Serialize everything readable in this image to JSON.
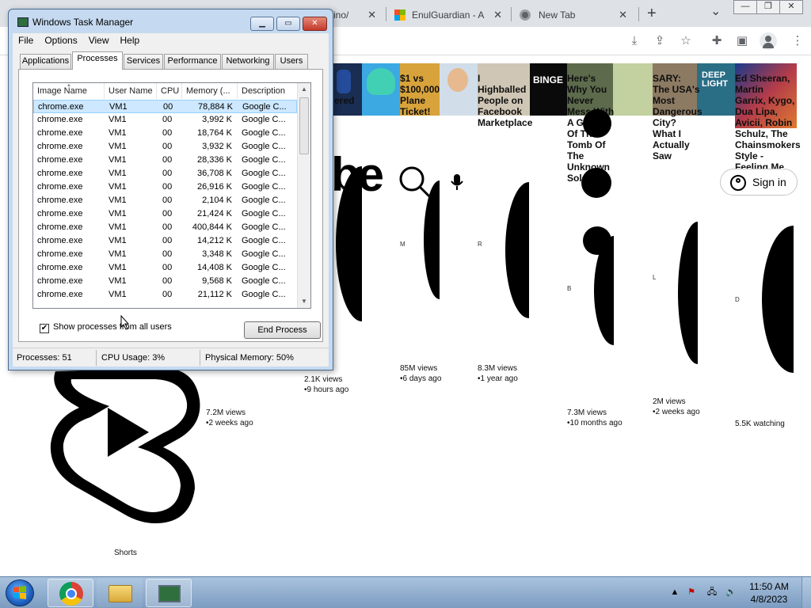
{
  "chrome": {
    "tabs": [
      {
        "label": "ino/"
      },
      {
        "label": "EnulGuardian - A"
      },
      {
        "label": "New Tab"
      }
    ],
    "new_tab_symbol": "+",
    "dropdown_symbol": "⌄",
    "close_symbol": "✕",
    "icons": [
      "download-icon",
      "share-icon",
      "bookmark-star-icon",
      "extensions-icon",
      "side-panel-icon",
      "profile-icon"
    ]
  },
  "youtube": {
    "sign_in_label": "Sign in",
    "logo_fragment": "be",
    "shorts_label": "Shorts",
    "binge_badge": "BINGE",
    "deep_light_badge": "DEEP LIGHT",
    "video_titles": [
      "ered",
      "$1 vs $100,000 Plane Ticket!",
      "I Highballed People on Facebook Marketplace",
      "Here's Why You Never Mess With A Guard Of The Tomb Of The Unknown Soldier",
      "SARY: The USA's Most Dangerous City? What I Actually Saw",
      "Ed Sheeran, Martin Garrix, Kygo, Dua Lipa, Avicii, Robin Schulz, The Chainsmokers Style - Feeling Me"
    ],
    "channel_initials": [
      "M",
      "R",
      "B",
      "L",
      "D"
    ],
    "video_meta": [
      {
        "views": "7.2M views",
        "age": "•2 weeks ago"
      },
      {
        "views": "2.1K views",
        "age": "•9 hours ago"
      },
      {
        "views": "85M views",
        "age": "•6 days ago"
      },
      {
        "views": "8.3M views",
        "age": "•1 year ago"
      },
      {
        "views": "7.3M views",
        "age": "•10 months ago"
      },
      {
        "views": "2M views",
        "age": "•2 weeks ago"
      },
      {
        "views": "5.5K watching",
        "age": ""
      }
    ]
  },
  "taskmgr": {
    "title": "Windows Task Manager",
    "menu": [
      "File",
      "Options",
      "View",
      "Help"
    ],
    "tabs": [
      "Applications",
      "Processes",
      "Services",
      "Performance",
      "Networking",
      "Users"
    ],
    "active_tab": "Processes",
    "columns": [
      "Image Name",
      "User Name",
      "CPU",
      "Memory (...",
      "Description"
    ],
    "rows": [
      {
        "image": "chrome.exe",
        "user": "VM1",
        "cpu": "00",
        "mem": "78,884 K",
        "desc": "Google C..."
      },
      {
        "image": "chrome.exe",
        "user": "VM1",
        "cpu": "00",
        "mem": "3,992 K",
        "desc": "Google C..."
      },
      {
        "image": "chrome.exe",
        "user": "VM1",
        "cpu": "00",
        "mem": "18,764 K",
        "desc": "Google C..."
      },
      {
        "image": "chrome.exe",
        "user": "VM1",
        "cpu": "00",
        "mem": "3,932 K",
        "desc": "Google C..."
      },
      {
        "image": "chrome.exe",
        "user": "VM1",
        "cpu": "00",
        "mem": "28,336 K",
        "desc": "Google C..."
      },
      {
        "image": "chrome.exe",
        "user": "VM1",
        "cpu": "00",
        "mem": "36,708 K",
        "desc": "Google C..."
      },
      {
        "image": "chrome.exe",
        "user": "VM1",
        "cpu": "00",
        "mem": "26,916 K",
        "desc": "Google C..."
      },
      {
        "image": "chrome.exe",
        "user": "VM1",
        "cpu": "00",
        "mem": "2,104 K",
        "desc": "Google C..."
      },
      {
        "image": "chrome.exe",
        "user": "VM1",
        "cpu": "00",
        "mem": "21,424 K",
        "desc": "Google C..."
      },
      {
        "image": "chrome.exe",
        "user": "VM1",
        "cpu": "00",
        "mem": "400,844 K",
        "desc": "Google C..."
      },
      {
        "image": "chrome.exe",
        "user": "VM1",
        "cpu": "00",
        "mem": "14,212 K",
        "desc": "Google C..."
      },
      {
        "image": "chrome.exe",
        "user": "VM1",
        "cpu": "00",
        "mem": "3,348 K",
        "desc": "Google C..."
      },
      {
        "image": "chrome.exe",
        "user": "VM1",
        "cpu": "00",
        "mem": "14,408 K",
        "desc": "Google C..."
      },
      {
        "image": "chrome.exe",
        "user": "VM1",
        "cpu": "00",
        "mem": "9,568 K",
        "desc": "Google C..."
      },
      {
        "image": "chrome.exe",
        "user": "VM1",
        "cpu": "00",
        "mem": "21,112 K",
        "desc": "Google C..."
      }
    ],
    "selected_row": 0,
    "show_all_users_label": "Show processes from all users",
    "show_all_users_checked": true,
    "end_process_label": "End Process",
    "status": {
      "processes": "Processes: 51",
      "cpu": "CPU Usage: 3%",
      "memory": "Physical Memory: 50%"
    }
  },
  "taskbar": {
    "clock_time": "11:50 AM",
    "clock_date": "4/8/2023"
  }
}
